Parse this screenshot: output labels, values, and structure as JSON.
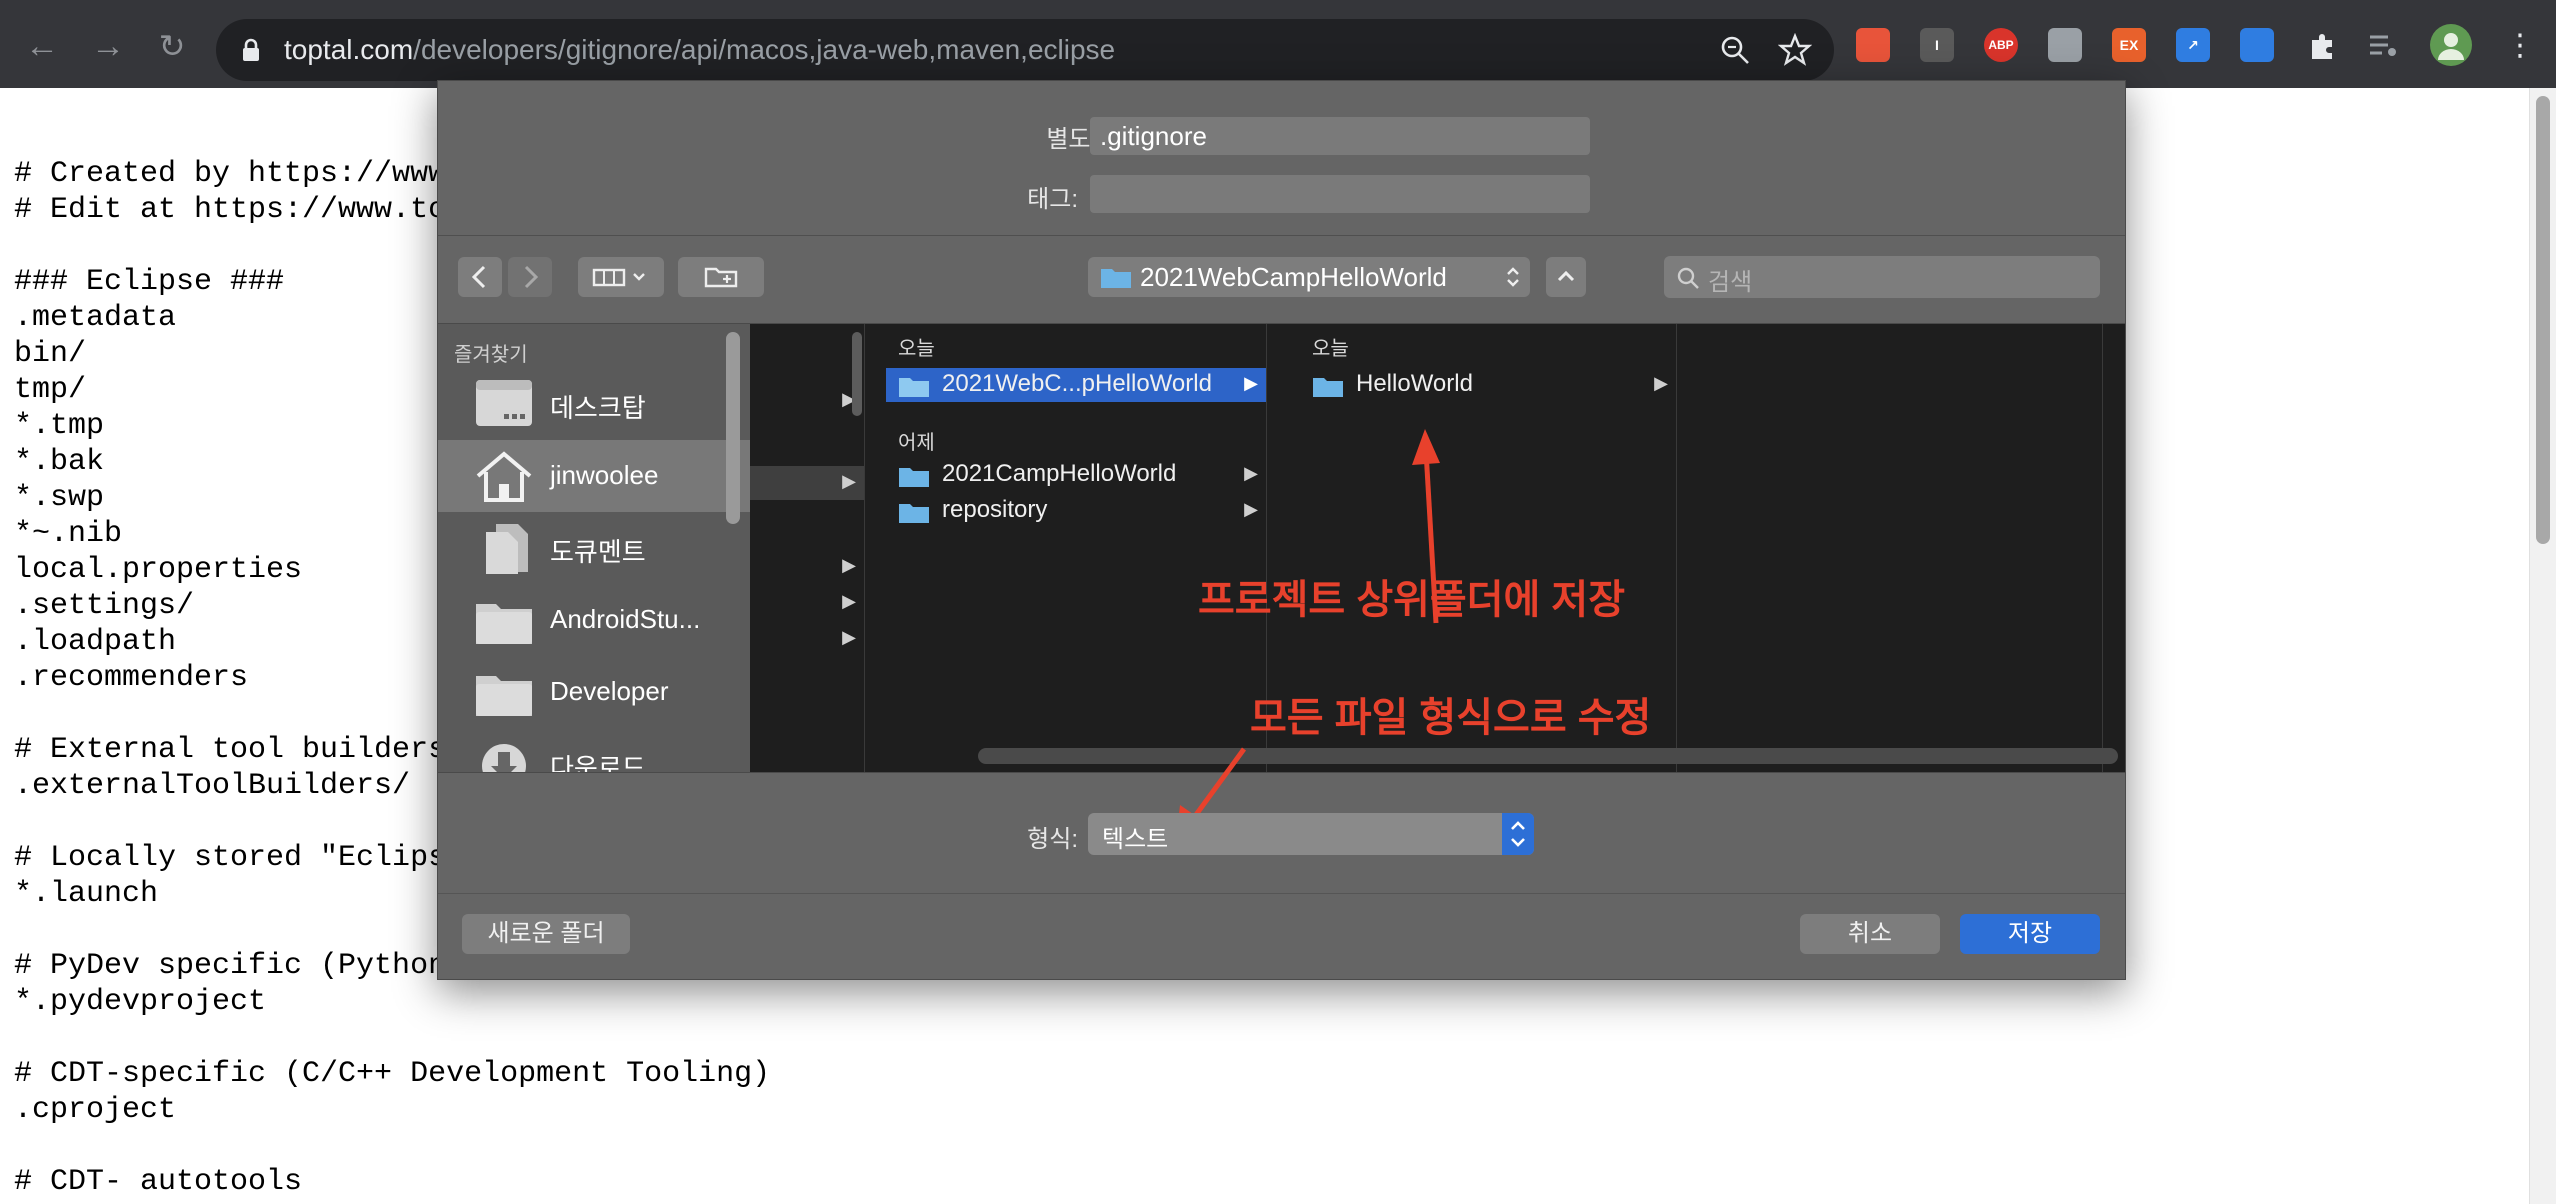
{
  "browser": {
    "url_host": "toptal.com",
    "url_path": "/developers/gitignore/api/macos,java-web,maven,eclipse",
    "extensions": [
      {
        "name": "toolbox-ext-icon",
        "color": "#e8543a",
        "text": ""
      },
      {
        "name": "reader-ext-icon",
        "color": "#5a5a5a",
        "text": "I"
      },
      {
        "name": "adblock-plus-icon",
        "color": "#d9342b",
        "text": "ABP"
      },
      {
        "name": "sync-ext-icon",
        "color": "#9aa0a6",
        "text": ""
      },
      {
        "name": "ex-ext-icon",
        "color": "#e8612c",
        "text": "EX"
      },
      {
        "name": "expand-ext-icon",
        "color": "#2f7de1",
        "text": "↗"
      },
      {
        "name": "window-ext-icon",
        "color": "#2f7de1",
        "text": ""
      }
    ]
  },
  "page": {
    "code_lines": [
      "# Created by https://www.toptal.com/developers/gitignore/api/macos,java-web,maven,eclipse",
      "# Edit at https://www.toptal.com/developers/gitignore?templates=macos,java-web,maven,eclipse",
      "",
      "### Eclipse ###",
      ".metadata",
      "bin/",
      "tmp/",
      "*.tmp",
      "*.bak",
      "*.swp",
      "*~.nib",
      "local.properties",
      ".settings/",
      ".loadpath",
      ".recommenders",
      "",
      "# External tool builders",
      ".externalToolBuilders/",
      "",
      "# Locally stored \"Eclipse launch configurations\"",
      "*.launch",
      "",
      "# PyDev specific (Python IDE for Eclipse)",
      "*.pydevproject",
      "",
      "# CDT-specific (C/C++ Development Tooling)",
      ".cproject",
      "",
      "# CDT- autotools"
    ]
  },
  "dialog": {
    "save_as_label": "별도 저장:",
    "save_as_value": ".gitignore",
    "tags_label": "태그:",
    "tags_value": "",
    "location": "2021WebCampHelloWorld",
    "search_placeholder": "검색",
    "sidebar": {
      "heading": "즐겨찾기",
      "items": [
        {
          "label": "데스크탑",
          "icon": "desktop-icon",
          "selected": false
        },
        {
          "label": "jinwoolee",
          "icon": "home-icon",
          "selected": true
        },
        {
          "label": "도큐멘트",
          "icon": "documents-icon",
          "selected": false
        },
        {
          "label": "AndroidStu...",
          "icon": "folder-icon",
          "selected": false
        },
        {
          "label": "Developer",
          "icon": "folder-icon",
          "selected": false
        },
        {
          "label": "다운로드",
          "icon": "downloads-icon",
          "selected": false
        }
      ]
    },
    "column2": {
      "today_heading": "오늘",
      "today_items": [
        {
          "name": "2021WebC...pHelloWorld",
          "selected": true
        }
      ],
      "yesterday_heading": "어제",
      "yesterday_items": [
        {
          "name": "2021CampHelloWorld",
          "selected": false
        },
        {
          "name": "repository",
          "selected": false
        }
      ]
    },
    "column3": {
      "today_heading": "오늘",
      "items": [
        {
          "name": "HelloWorld",
          "selected": false
        }
      ]
    },
    "format_label": "형식:",
    "format_value": "텍스트",
    "new_folder_label": "새로운 폴더",
    "cancel_label": "취소",
    "save_label": "저장"
  },
  "annotations": {
    "save_parent_note": "프로젝트 상위폴더에 저장",
    "format_note": "모든 파일 형식으로 수정",
    "color": "#e8412c"
  }
}
